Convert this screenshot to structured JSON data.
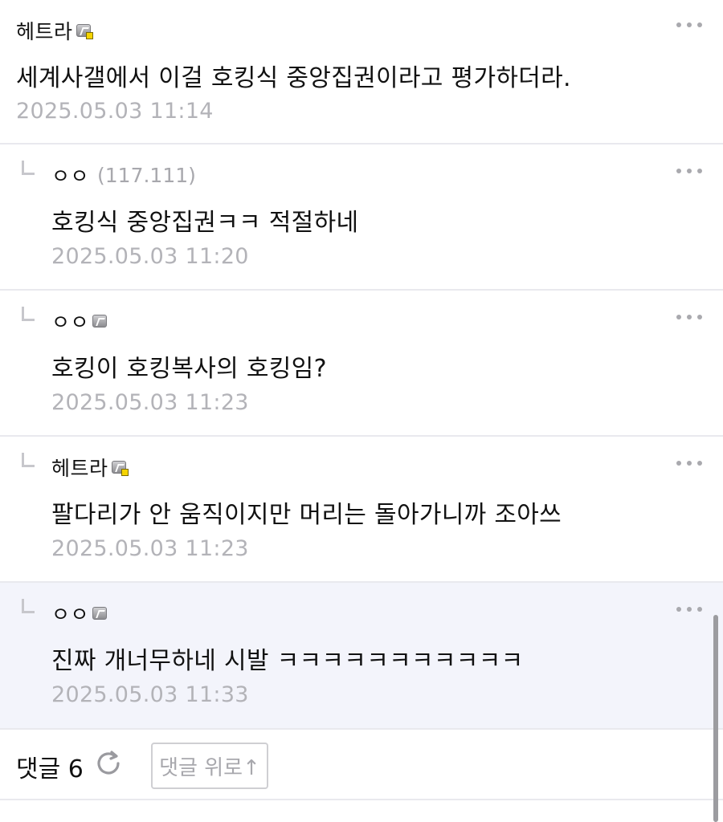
{
  "comments": [
    {
      "author": "헤트라",
      "ip": "",
      "text": "세계사갤에서 이걸 호킹식 중앙집권이라고 평가하더라.",
      "date": "2025.05.03 11:14"
    },
    {
      "author": "ㅇㅇ",
      "ip": "(117.111)",
      "text": "호킹식 중앙집권ㅋㅋ 적절하네",
      "date": "2025.05.03 11:20"
    },
    {
      "author": "ㅇㅇ",
      "ip": "",
      "text": "호킹이 호킹복사의 호킹임?",
      "date": "2025.05.03 11:23"
    },
    {
      "author": "헤트라",
      "ip": "",
      "text": "팔다리가 안 움직이지만 머리는 돌아가니까 조아쓰",
      "date": "2025.05.03 11:23"
    },
    {
      "author": "ㅇㅇ",
      "ip": "",
      "text": "진짜 개너무하네 시발 ㅋㅋㅋㅋㅋㅋㅋㅋㅋㅋㅋ",
      "date": "2025.05.03 11:33"
    }
  ],
  "footer": {
    "count_label": "댓글 6",
    "to_top_label": "댓글 위로↑"
  },
  "icons": {
    "more": "more-icon",
    "refresh": "refresh-icon",
    "reply": "reply-arrow-icon",
    "badge": "member-badge-icon"
  },
  "colors": {
    "highlight_bg": "#f3f4fb",
    "meta_gray": "#b3b3b8",
    "badge_yellow": "#f5d400"
  }
}
